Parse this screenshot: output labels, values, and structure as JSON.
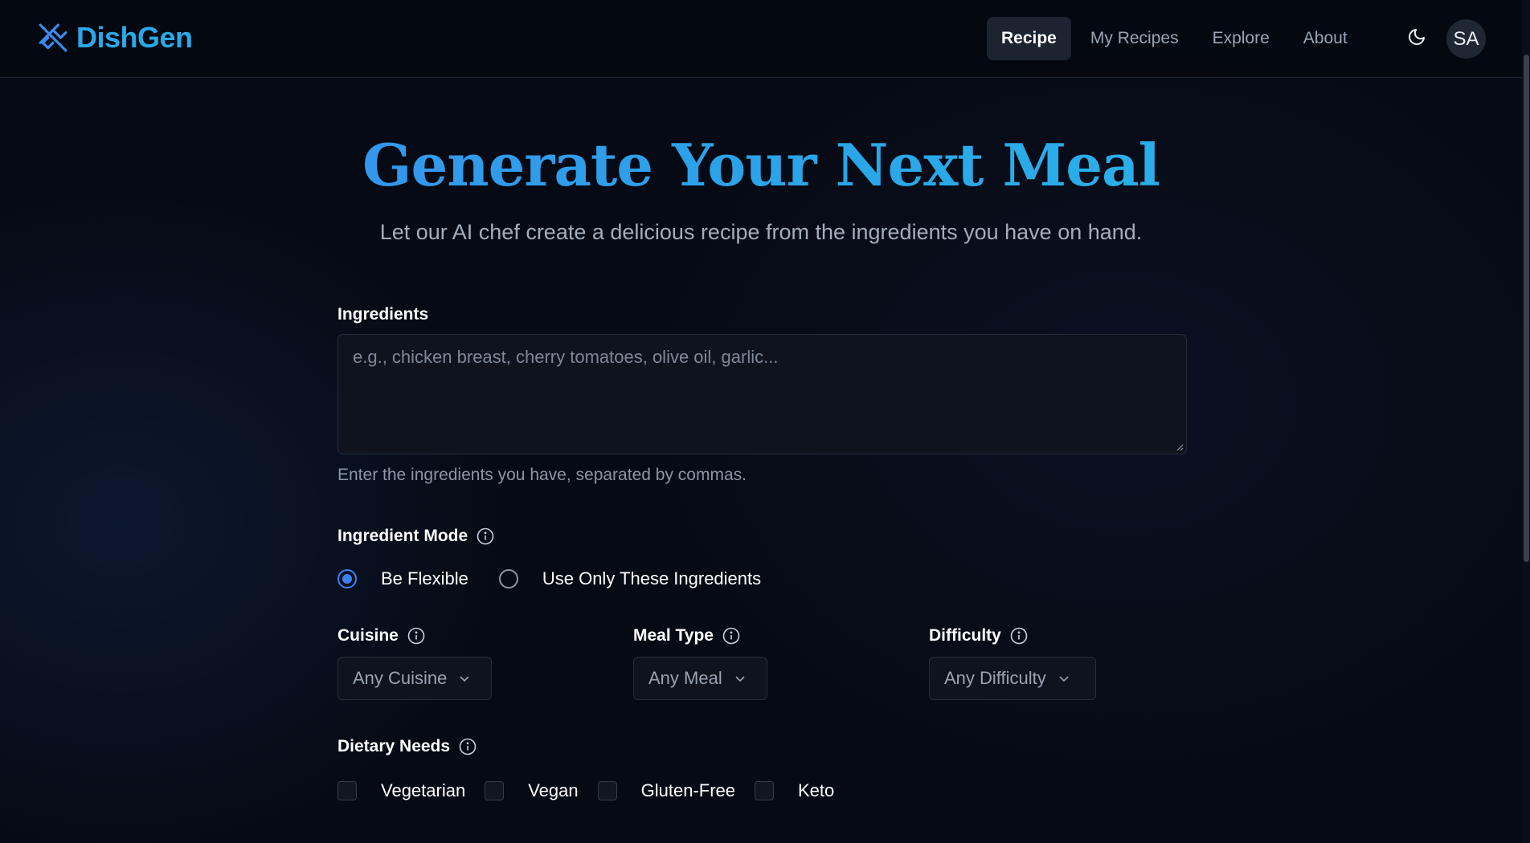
{
  "app": {
    "name": "DishGen",
    "brand_color": "#2aa8e8",
    "logo_icon": "utensils-icon"
  },
  "nav": {
    "links": [
      {
        "label": "Recipe",
        "active": true
      },
      {
        "label": "My Recipes",
        "active": false
      },
      {
        "label": "Explore",
        "active": false
      },
      {
        "label": "About",
        "active": false
      }
    ],
    "theme_icon": "moon-icon",
    "avatar_initials": "SA"
  },
  "hero": {
    "title": "Generate Your Next Meal",
    "subtitle": "Let our AI chef create a delicious recipe from the ingredients you have on hand."
  },
  "form": {
    "ingredients": {
      "label": "Ingredients",
      "placeholder": "e.g., chicken breast, cherry tomatoes, olive oil, garlic...",
      "value": "",
      "helper": "Enter the ingredients you have, separated by commas."
    },
    "ingredient_mode": {
      "label": "Ingredient Mode",
      "options": [
        {
          "label": "Be Flexible",
          "checked": true
        },
        {
          "label": "Use Only These Ingredients",
          "checked": false
        }
      ]
    },
    "cuisine": {
      "label": "Cuisine",
      "selected": "Any Cuisine"
    },
    "meal_type": {
      "label": "Meal Type",
      "selected": "Any Meal"
    },
    "difficulty": {
      "label": "Difficulty",
      "selected": "Any Difficulty"
    },
    "dietary": {
      "label": "Dietary Needs",
      "options": [
        {
          "label": "Vegetarian",
          "checked": false
        },
        {
          "label": "Vegan",
          "checked": false
        },
        {
          "label": "Gluten-Free",
          "checked": false
        },
        {
          "label": "Keto",
          "checked": false
        }
      ]
    }
  },
  "colors": {
    "accent": "#3b82f6",
    "background": "#060a14"
  }
}
